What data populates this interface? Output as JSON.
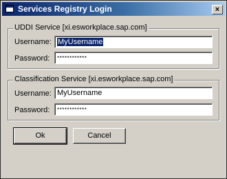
{
  "window": {
    "title": "Services Registry Login",
    "close_label": "×"
  },
  "uddi": {
    "legend": "UDDI Service [xi.esworkplace.sap.com]",
    "username_label": "Username:",
    "username_value": "MyUsername",
    "password_label": "Password:",
    "password_value": "************"
  },
  "classification": {
    "legend": "Classification Service [xi.esworkplace.sap.com]",
    "username_label": "Username:",
    "username_value": "MyUsername",
    "password_label": "Password:",
    "password_value": "************"
  },
  "buttons": {
    "ok": "Ok",
    "cancel": "Cancel"
  }
}
